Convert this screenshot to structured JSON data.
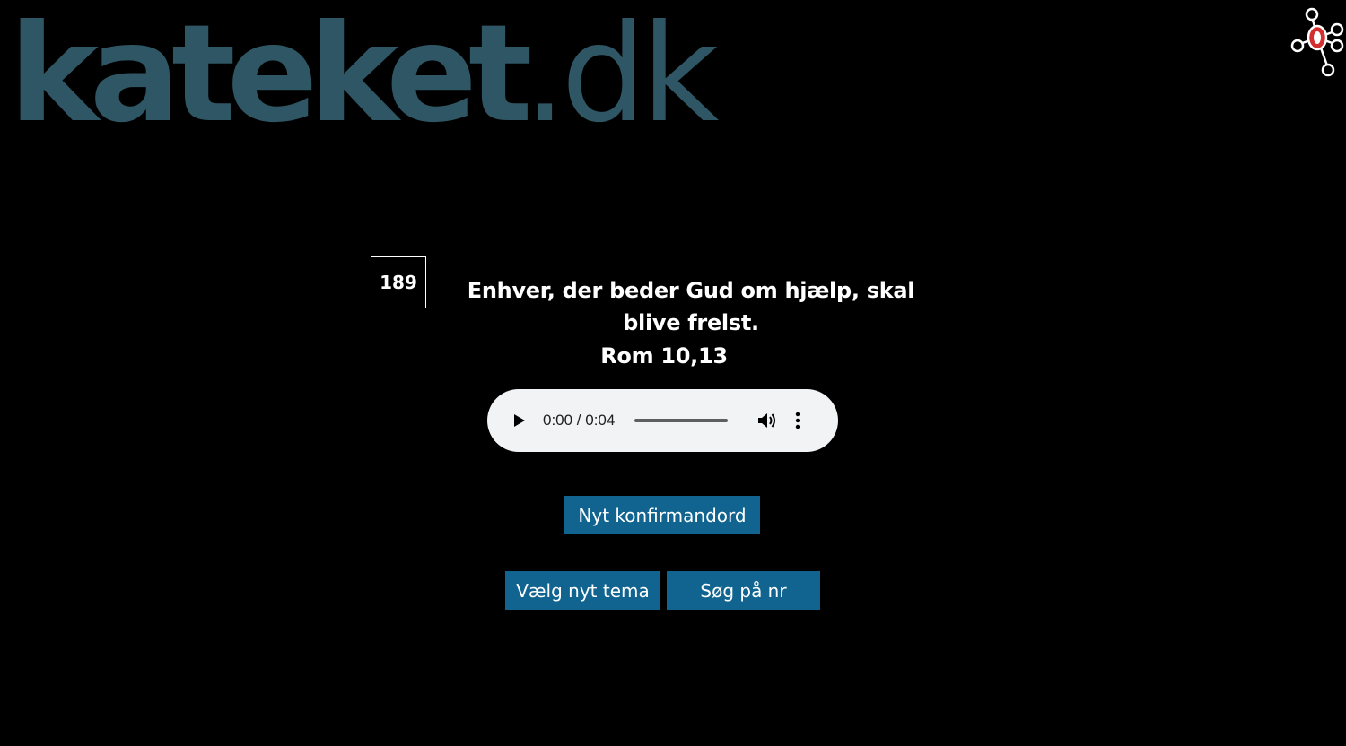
{
  "logo": {
    "main": "kateket",
    "tld": ".dk"
  },
  "verse": {
    "number": "189",
    "text": "Enhver, der beder Gud om hjælp, skal blive frelst.",
    "reference": "Rom 10,13"
  },
  "audio": {
    "time": "0:00 / 0:04",
    "progress": 0
  },
  "buttons": {
    "new_word": "Nyt konfirmandord",
    "choose_theme": "Vælg nyt tema",
    "search_number": "Søg på nr"
  },
  "colors": {
    "background": "#000000",
    "logo": "#2f5664",
    "button": "#10648f",
    "text": "#ffffff",
    "icon_accent": "#d32f2f"
  },
  "icons": {
    "corner": "network-graph-icon",
    "play": "play-icon",
    "volume": "volume-icon",
    "more": "more-vertical-icon"
  }
}
